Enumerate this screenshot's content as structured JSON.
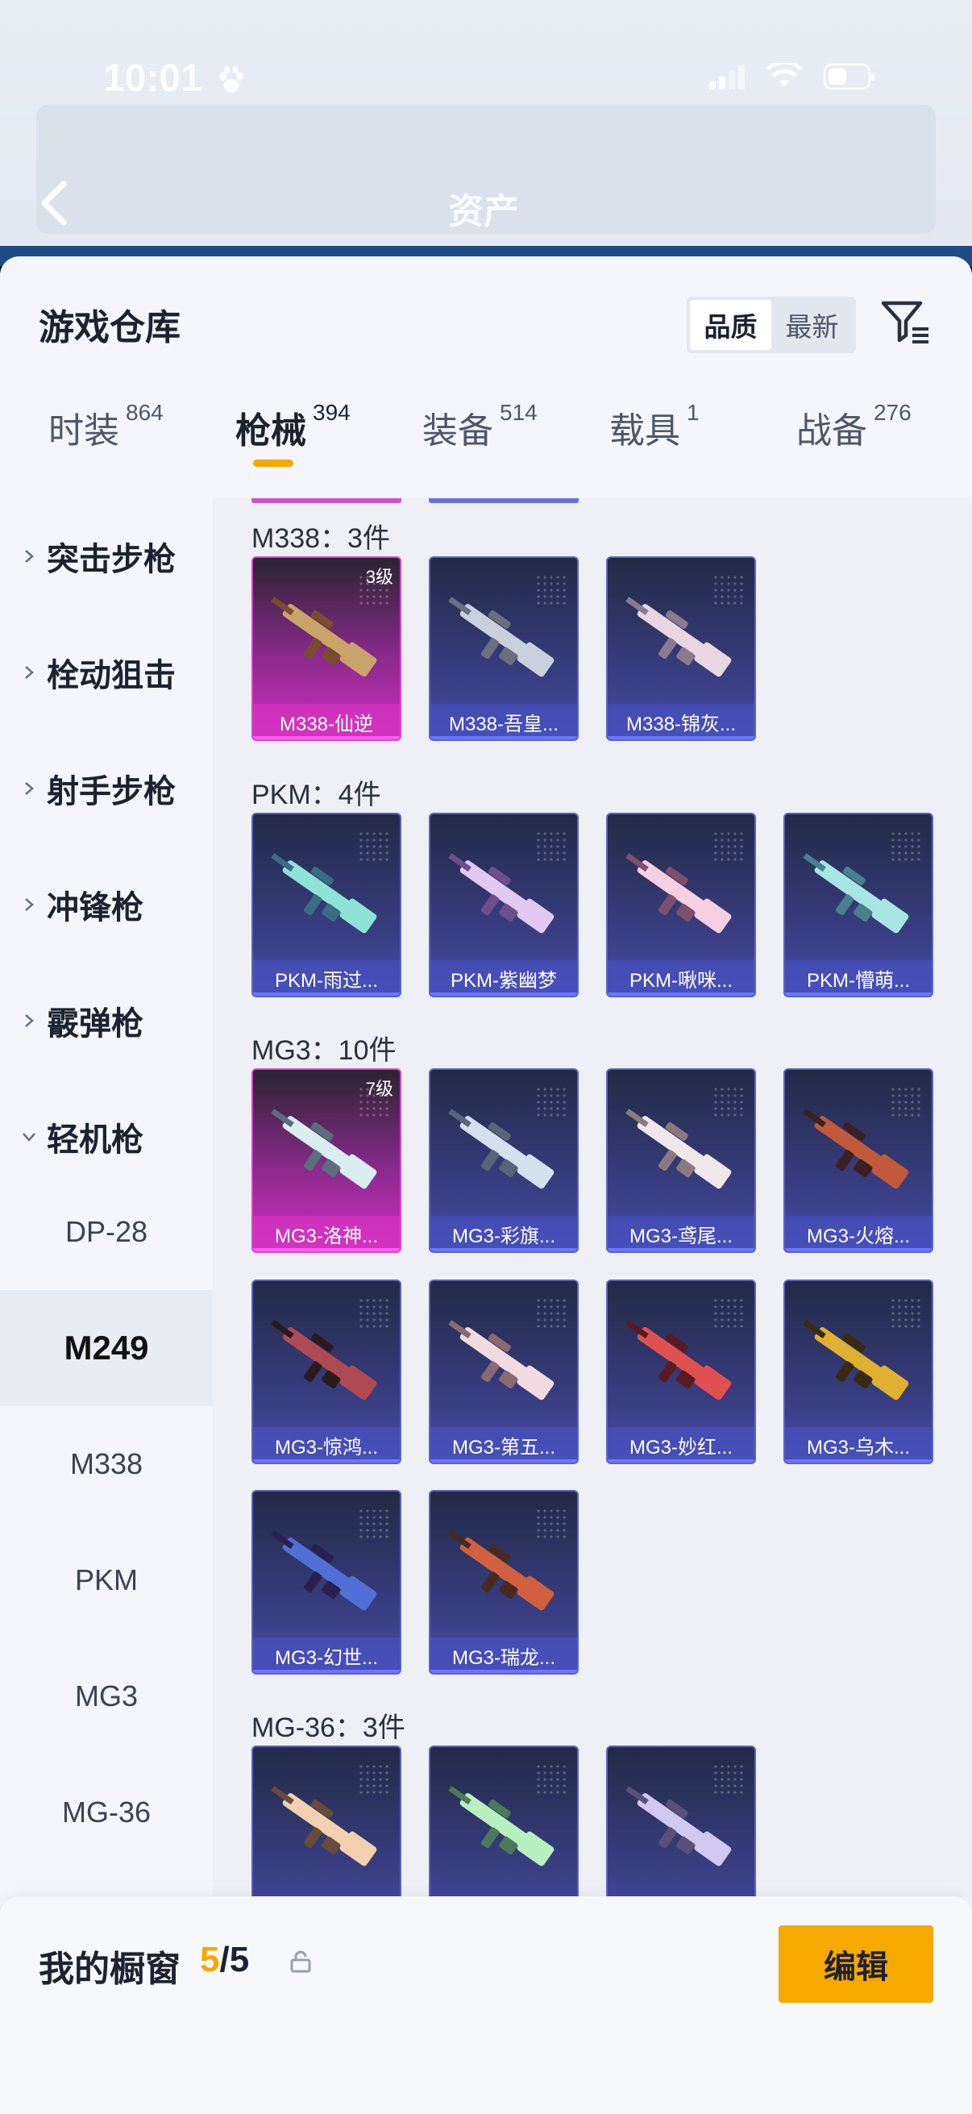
{
  "status_bar": {
    "time": "10:01"
  },
  "page": {
    "title": "资产"
  },
  "sheet": {
    "title": "游戏仓库",
    "sort_options": [
      {
        "label": "品质",
        "active": true
      },
      {
        "label": "最新",
        "active": false
      }
    ]
  },
  "tabs": [
    {
      "label": "时装",
      "count": "864",
      "active": false
    },
    {
      "label": "枪械",
      "count": "394",
      "active": true
    },
    {
      "label": "装备",
      "count": "514",
      "active": false
    },
    {
      "label": "载具",
      "count": "1",
      "active": false
    },
    {
      "label": "战备",
      "count": "276",
      "active": false
    }
  ],
  "sidebar": {
    "categories": [
      "突击步枪",
      "栓动狙击",
      "射手步枪",
      "冲锋枪",
      "霰弹枪",
      "轻机枪"
    ],
    "subcategories": [
      "DP-28",
      "M249",
      "M338",
      "PKM",
      "MG3",
      "MG-36"
    ],
    "active_sub": "M249"
  },
  "groups": [
    {
      "title": "M338：3件",
      "items": [
        {
          "name": "M338-仙逆",
          "level": "3级",
          "rarity": "gold"
        },
        {
          "name": "M338-吾皇...",
          "rarity": "purple"
        },
        {
          "name": "M338-锦灰...",
          "rarity": "purple"
        }
      ]
    },
    {
      "title": "PKM：4件",
      "items": [
        {
          "name": "PKM-雨过...",
          "rarity": "purple"
        },
        {
          "name": "PKM-紫幽梦",
          "rarity": "purple"
        },
        {
          "name": "PKM-啾咪...",
          "rarity": "purple"
        },
        {
          "name": "PKM-懵萌...",
          "rarity": "purple"
        }
      ]
    },
    {
      "title": "MG3：10件",
      "items": [
        {
          "name": "MG3-洛神...",
          "level": "7级",
          "rarity": "gold"
        },
        {
          "name": "MG3-彩旗...",
          "rarity": "purple"
        },
        {
          "name": "MG3-鸢尾...",
          "rarity": "purple"
        },
        {
          "name": "MG3-火熔...",
          "rarity": "purple"
        },
        {
          "name": "MG3-惊鸿...",
          "rarity": "purple"
        },
        {
          "name": "MG3-第五...",
          "rarity": "purple"
        },
        {
          "name": "MG3-妙红...",
          "rarity": "purple"
        },
        {
          "name": "MG3-乌木...",
          "rarity": "purple"
        },
        {
          "name": "MG3-幻世...",
          "rarity": "purple"
        },
        {
          "name": "MG3-瑞龙...",
          "rarity": "purple"
        }
      ]
    },
    {
      "title": "MG-36：3件",
      "items": [
        {
          "name": "",
          "rarity": "purple"
        },
        {
          "name": "",
          "rarity": "purple"
        },
        {
          "name": "",
          "rarity": "purple"
        }
      ]
    }
  ],
  "showcase": {
    "label": "我的橱窗",
    "current": "5",
    "total": "/5",
    "edit_label": "编辑"
  },
  "colors": {
    "accent": "#f7a900",
    "gold_card": "#d02fc2",
    "purple_card": "#4c4fb0"
  }
}
